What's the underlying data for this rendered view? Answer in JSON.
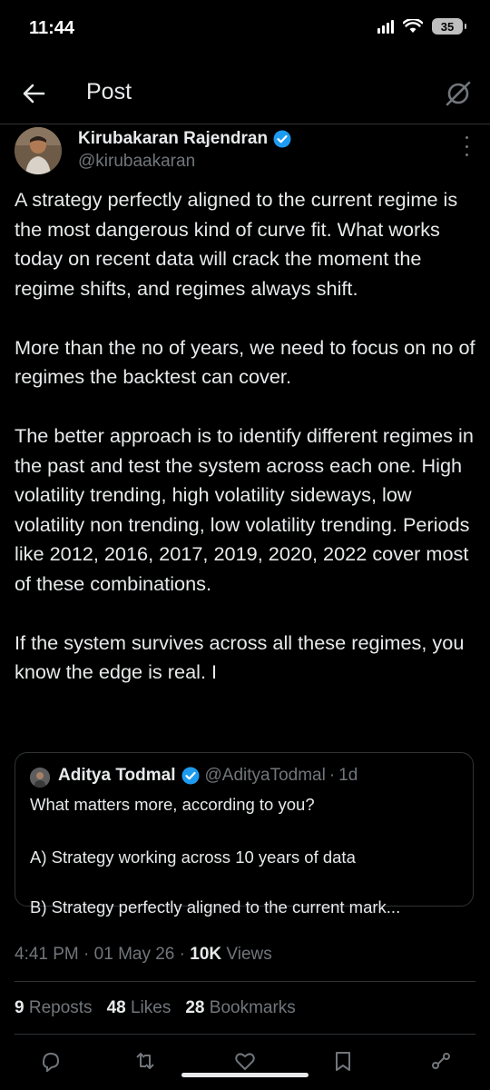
{
  "status": {
    "time": "11:44",
    "battery": "35"
  },
  "header": {
    "title": "Post"
  },
  "post": {
    "author_name": "Kirubakaran Rajendran",
    "author_handle": "@kirubaakaran",
    "body": "A strategy perfectly aligned to the current regime is the most dangerous kind of curve fit. What works today on recent data will crack the moment the regime shifts, and regimes always shift.\n\nMore than the no of years, we need to focus on no of regimes the backtest can cover.\n\nThe better approach is to identify different regimes in the past and test the system across each one. High volatility trending, high volatility sideways, low volatility non trending, low volatility trending. Periods like 2012, 2016, 2017, 2019, 2020, 2022 cover most of these combinations.\n\nIf the system survives across all these regimes, you know the edge is real. I",
    "time": "4:41 PM",
    "date": "01 May 26",
    "views_count": "10K",
    "views_label": "Views"
  },
  "quote": {
    "author_name": "Aditya Todmal",
    "author_handle": "@AdityaTodmal",
    "age": "1d",
    "line1": "What matters more, according to you?",
    "line2": "A) Strategy working across 10 years of data",
    "line3": "B) Strategy perfectly aligned to the current mark..."
  },
  "stats": {
    "reposts_count": "9",
    "reposts_label": "Reposts",
    "likes_count": "48",
    "likes_label": "Likes",
    "bookmarks_count": "28",
    "bookmarks_label": "Bookmarks"
  },
  "colors": {
    "accent": "#1d9bf0",
    "muted": "#71767b",
    "text": "#e7e9ea",
    "border": "#2f3336"
  }
}
